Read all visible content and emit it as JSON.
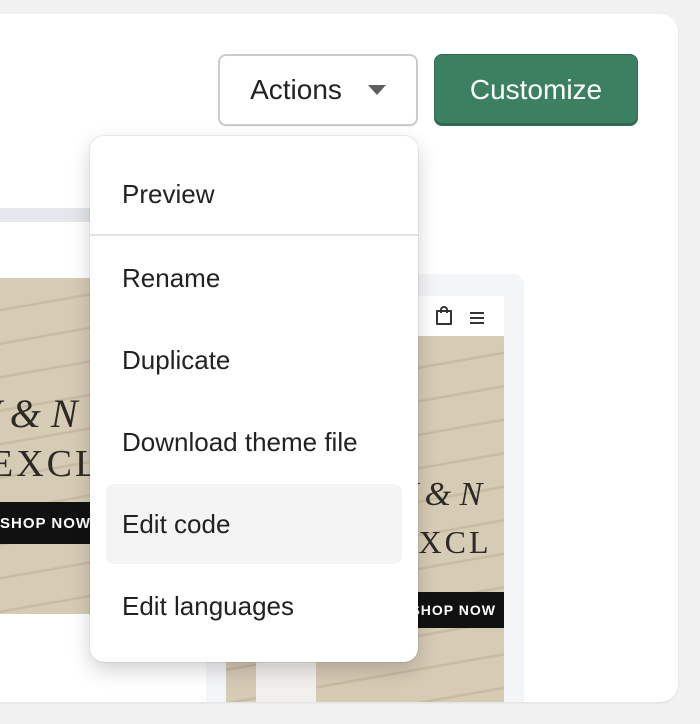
{
  "toolbar": {
    "actions_label": "Actions",
    "customize_label": "Customize"
  },
  "dropdown": {
    "items": [
      {
        "label": "Preview"
      },
      {
        "label": "Rename"
      },
      {
        "label": "Duplicate"
      },
      {
        "label": "Download theme file"
      },
      {
        "label": "Edit code",
        "highlighted": true
      },
      {
        "label": "Edit languages"
      }
    ]
  },
  "previews": {
    "desktop": {
      "script_text": "V & N",
      "caps_text": "EXCLU",
      "button_text": "SHOP NOW"
    },
    "mobile": {
      "script_text": "V & N",
      "caps_text": "EXCL",
      "button_text": "SHOP NOW",
      "icons": [
        "shopping-bag-icon",
        "hamburger-menu-icon"
      ]
    }
  },
  "colors": {
    "primary_button": "#3b8061",
    "hover_row": "#f4f4f4"
  }
}
